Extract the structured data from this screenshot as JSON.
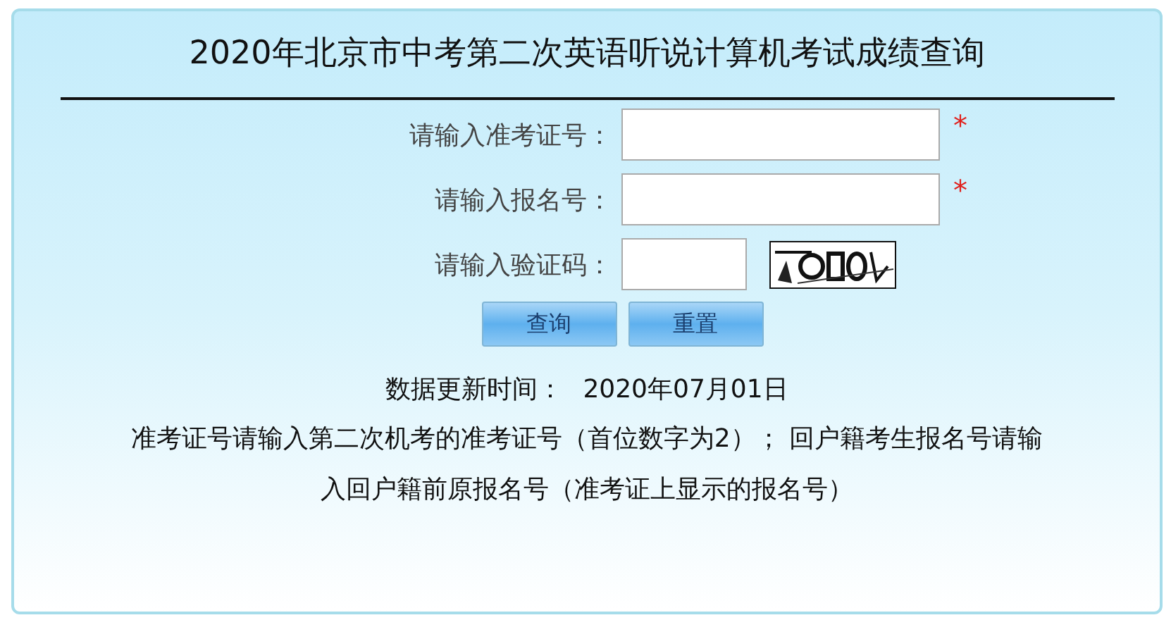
{
  "title": "2020年北京市中考第二次英语听说计算机考试成绩查询",
  "form_rows": [
    {
      "label": "请输入准考证号：",
      "kind": "text",
      "required_mark": "*"
    },
    {
      "label": "请输入报名号：",
      "kind": "text",
      "required_mark": "*"
    },
    {
      "label": "请输入验证码：",
      "kind": "captcha"
    }
  ],
  "buttons": [
    "查询",
    "重置"
  ],
  "update_time": {
    "label": "数据更新时间：",
    "value": "2020年07月01日"
  },
  "note": "准考证号请输入第二次机考的准考证号（首位数字为2）； 回户籍考生报名号请输入回户籍前原报名号（准考证上显示的报名号）"
}
